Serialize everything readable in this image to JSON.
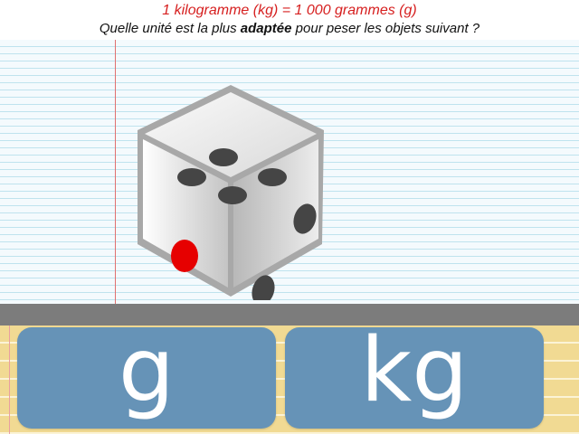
{
  "header": {
    "rule": "1 kilogramme (kg) = 1 000 grammes (g)",
    "rule_color": "#d61f1f",
    "question_before": "Quelle unité est la plus ",
    "question_bold": "adaptée",
    "question_after": " pour peser les objets suivant ?"
  },
  "object": {
    "icon": "dice-icon",
    "face_colors": [
      "#f5f5f5",
      "#bfbfbf",
      "#e6e6e6"
    ],
    "pip_color": "#454545",
    "highlight_pip_color": "#e60000"
  },
  "answers": [
    {
      "label": "g"
    },
    {
      "label": "kg"
    }
  ],
  "colors": {
    "button": "#6693b7",
    "paper_line": "#bfe3ee",
    "margin_line": "#e07070",
    "shelf": "#7c7c7c",
    "tray": "#f1da93"
  }
}
